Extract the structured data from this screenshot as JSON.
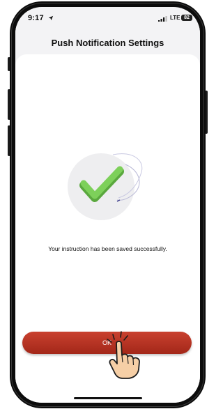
{
  "status_bar": {
    "time": "9:17",
    "network": "LTE",
    "battery": "82"
  },
  "header": {
    "title": "Push Notification Settings"
  },
  "main": {
    "message": "Your instruction has been saved successfully.",
    "ok_label": "OK"
  },
  "colors": {
    "button_red": "#b5301f",
    "check_green": "#6cc04a"
  },
  "icons": {
    "location": "location-arrow-icon",
    "signal": "signal-bars-icon",
    "battery": "battery-icon",
    "success": "checkmark-icon",
    "pointer": "tap-hand-icon"
  }
}
